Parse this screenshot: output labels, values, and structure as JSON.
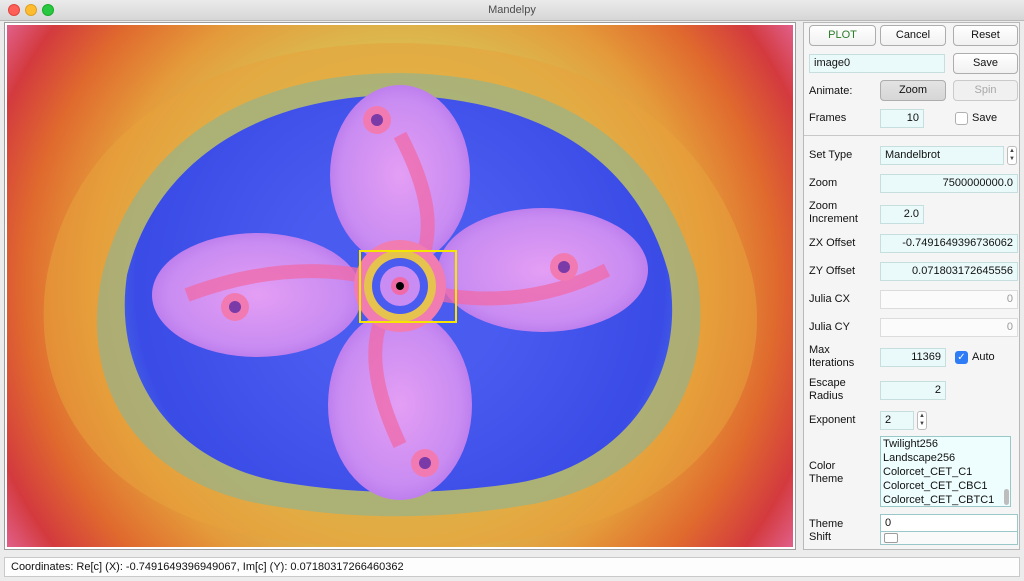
{
  "window": {
    "title": "Mandelpy"
  },
  "toolbar": {
    "plot_label": "PLOT",
    "cancel_label": "Cancel",
    "reset_label": "Reset",
    "save_label": "Save",
    "filename": "image0"
  },
  "animate": {
    "label": "Animate:",
    "zoom_label": "Zoom",
    "spin_label": "Spin",
    "frames_label": "Frames",
    "frames_value": "10",
    "save_label": "Save",
    "save_checked": false
  },
  "params": {
    "set_type_label": "Set Type",
    "set_type_value": "Mandelbrot",
    "zoom_label": "Zoom",
    "zoom_value": "7500000000.0",
    "zoom_increment_label_1": "Zoom",
    "zoom_increment_label_2": "Increment",
    "zoom_increment_value": "2.0",
    "zx_offset_label": "ZX Offset",
    "zx_offset_value": "-0.7491649396736062",
    "zy_offset_label": "ZY Offset",
    "zy_offset_value": "0.071803172645556",
    "julia_cx_label": "Julia CX",
    "julia_cx_value": "0",
    "julia_cy_label": "Julia CY",
    "julia_cy_value": "0",
    "max_iter_label_1": "Max",
    "max_iter_label_2": "Iterations",
    "max_iter_value": "11369",
    "auto_label": "Auto",
    "auto_checked": true,
    "escape_label_1": "Escape",
    "escape_label_2": "Radius",
    "escape_value": "2",
    "exponent_label": "Exponent",
    "exponent_value": "2",
    "color_theme_label_1": "Color",
    "color_theme_label_2": "Theme",
    "color_themes": [
      "Twilight256",
      "Landscape256",
      "Colorcet_CET_C1",
      "Colorcet_CET_CBC1",
      "Colorcet_CET_CBTC1"
    ],
    "theme_shift_label_1": "Theme",
    "theme_shift_label_2": "Shift",
    "theme_shift_value": "0"
  },
  "status": {
    "coordinates": "Coordinates: Re[c] (X): -0.7491649396949067,  Im[c] (Y): 0.07180317266460362"
  },
  "colors": {
    "plot_text": "#2a7d2a",
    "field_bg": "#eafafa",
    "checkbox_on": "#2e7cf6",
    "zoom_box": "#f4e600"
  }
}
